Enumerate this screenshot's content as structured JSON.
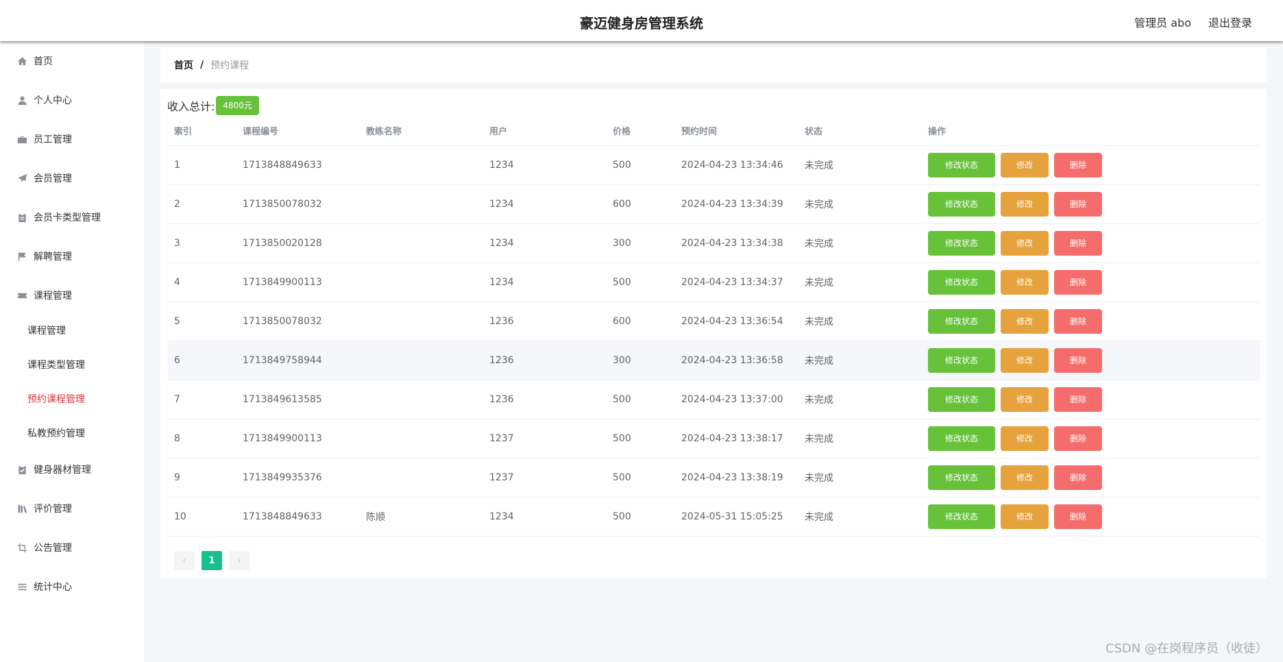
{
  "header": {
    "title": "豪迈健身房管理系统",
    "admin": "管理员 abo",
    "logout": "退出登录"
  },
  "sidebar": {
    "items": [
      {
        "label": "首页",
        "icon": "home-icon"
      },
      {
        "label": "个人中心",
        "icon": "user-icon"
      },
      {
        "label": "员工管理",
        "icon": "briefcase-icon"
      },
      {
        "label": "会员管理",
        "icon": "paper-plane-icon"
      },
      {
        "label": "会员卡类型管理",
        "icon": "clipboard-icon"
      },
      {
        "label": "解聘管理",
        "icon": "flag-icon"
      },
      {
        "label": "课程管理",
        "icon": "ticket-icon"
      },
      {
        "label": "健身器材管理",
        "icon": "checklist-icon"
      },
      {
        "label": "评价管理",
        "icon": "books-icon"
      },
      {
        "label": "公告管理",
        "icon": "crop-icon"
      },
      {
        "label": "统计中心",
        "icon": "list-icon"
      }
    ],
    "sub_items": [
      {
        "label": "课程管理"
      },
      {
        "label": "课程类型管理"
      },
      {
        "label": "预约课程管理"
      },
      {
        "label": "私教预约管理"
      }
    ]
  },
  "breadcrumb": {
    "home": "首页",
    "sep": "/",
    "current": "预约课程"
  },
  "income": {
    "label": "收入总计:",
    "value": "4800元"
  },
  "table": {
    "headers": [
      "索引",
      "课程编号",
      "教练名称",
      "用户",
      "价格",
      "预约时间",
      "状态",
      "操作"
    ],
    "rows": [
      {
        "index": "1",
        "course_no": "1713848849633",
        "coach": "",
        "user": "1234",
        "price": "500",
        "time": "2024-04-23 13:34:46",
        "status": "未完成"
      },
      {
        "index": "2",
        "course_no": "1713850078032",
        "coach": "",
        "user": "1234",
        "price": "600",
        "time": "2024-04-23 13:34:39",
        "status": "未完成"
      },
      {
        "index": "3",
        "course_no": "1713850020128",
        "coach": "",
        "user": "1234",
        "price": "300",
        "time": "2024-04-23 13:34:38",
        "status": "未完成"
      },
      {
        "index": "4",
        "course_no": "1713849900113",
        "coach": "",
        "user": "1234",
        "price": "500",
        "time": "2024-04-23 13:34:37",
        "status": "未完成"
      },
      {
        "index": "5",
        "course_no": "1713850078032",
        "coach": "",
        "user": "1236",
        "price": "600",
        "time": "2024-04-23 13:36:54",
        "status": "未完成"
      },
      {
        "index": "6",
        "course_no": "1713849758944",
        "coach": "",
        "user": "1236",
        "price": "300",
        "time": "2024-04-23 13:36:58",
        "status": "未完成"
      },
      {
        "index": "7",
        "course_no": "1713849613585",
        "coach": "",
        "user": "1236",
        "price": "500",
        "time": "2024-04-23 13:37:00",
        "status": "未完成"
      },
      {
        "index": "8",
        "course_no": "1713849900113",
        "coach": "",
        "user": "1237",
        "price": "500",
        "time": "2024-04-23 13:38:17",
        "status": "未完成"
      },
      {
        "index": "9",
        "course_no": "1713849935376",
        "coach": "",
        "user": "1237",
        "price": "500",
        "time": "2024-04-23 13:38:19",
        "status": "未完成"
      },
      {
        "index": "10",
        "course_no": "1713848849633",
        "coach": "陈顺",
        "user": "1234",
        "price": "500",
        "time": "2024-05-31 15:05:25",
        "status": "未完成"
      }
    ],
    "actions": {
      "status_label": "修改状态",
      "edit_label": "修改",
      "delete_label": "删除"
    }
  },
  "pagination": {
    "prev": "‹",
    "current": "1",
    "next": "›"
  },
  "watermark": "CSDN @在岗程序员（收徒）",
  "colors": {
    "status_button": "#67c23a",
    "edit_button": "#e6a23c",
    "delete_button": "#f56c6c",
    "active_page": "#18c08f",
    "active_menu": "#e0323a"
  }
}
